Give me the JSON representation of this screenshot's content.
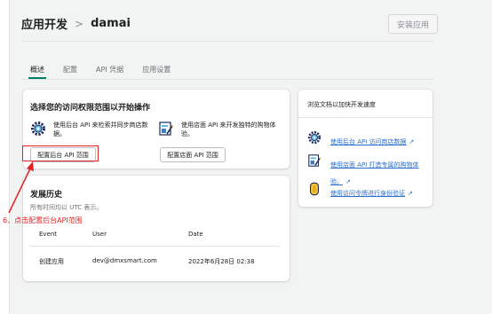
{
  "header": {
    "crumb": "应用开发",
    "separator": ">",
    "app_name": "damai",
    "install_label": "安装应用"
  },
  "tabs": [
    {
      "label": "概述",
      "active": true
    },
    {
      "label": "配置",
      "active": false
    },
    {
      "label": "API 凭据",
      "active": false
    },
    {
      "label": "应用设置",
      "active": false
    }
  ],
  "access_card": {
    "title": "选择您的访问权限范围以开始操作",
    "admin": {
      "text": "使用后台 API 来检索并同步商店数据。",
      "button": "配置后台 API 范围",
      "icon": "gear-icon"
    },
    "storefront": {
      "text": "使用店面 API 来开发独特的购物体验。",
      "button": "配置店面 API 范围",
      "icon": "storefront-icon"
    }
  },
  "annotation": {
    "text": "6、点击配置后台API范围",
    "color": "#e02424"
  },
  "history": {
    "title": "发展历史",
    "subtitle": "所有时间均以 UTC 表示。",
    "columns": [
      "Event",
      "User",
      "Date"
    ],
    "rows": [
      {
        "event": "创建应用",
        "user": "dev@dmxsmart.com",
        "date": "2022年6月28日 02:38"
      }
    ]
  },
  "docs": {
    "title": "浏览文档以加快开发速度",
    "links": [
      {
        "label": "使用后台 API 访问商店数据",
        "icon": "gear-icon"
      },
      {
        "label": "使用店面 API 打造专属的购物体验。",
        "icon": "storefront-icon"
      },
      {
        "label": "使用访问令牌进行身份验证",
        "icon": "token-icon"
      }
    ]
  },
  "colors": {
    "accent": "#008060",
    "link": "#2c6ecb",
    "annotation": "#e02424"
  }
}
